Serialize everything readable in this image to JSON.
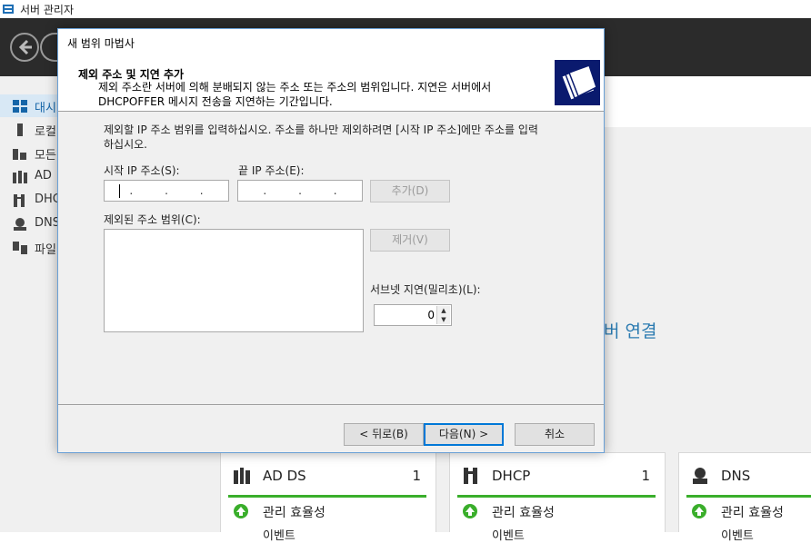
{
  "app": {
    "title": "서버 관리자"
  },
  "sidebar": {
    "items": [
      {
        "label": "대시",
        "icon": "dashboard-icon",
        "active": true
      },
      {
        "label": "로컬",
        "icon": "local-server-icon"
      },
      {
        "label": "모든",
        "icon": "all-servers-icon"
      },
      {
        "label": "AD",
        "icon": "ad-icon"
      },
      {
        "label": "DHC",
        "icon": "dhcp-icon"
      },
      {
        "label": "DNS",
        "icon": "dns-icon"
      },
      {
        "label": "파일",
        "icon": "file-services-icon"
      }
    ]
  },
  "main": {
    "connect_link": "버 연결",
    "tiles": [
      {
        "name": "AD DS",
        "count": "1",
        "status": "관리 효율성",
        "events": "이벤트"
      },
      {
        "name": "DHCP",
        "count": "1",
        "status": "관리 효율성",
        "events": "이벤트"
      },
      {
        "name": "DNS",
        "count": "",
        "status": "관리 효율성",
        "events": "이벤트"
      }
    ]
  },
  "dialog": {
    "title": "새 범위 마법사",
    "header_title": "제외 주소 및 지연 추가",
    "header_desc": "제외 주소란 서버에 의해 분배되지 않는 주소 또는 주소의 범위입니다. 지연은 서버에서 DHCPOFFER 메시지 전송을 지연하는 기간입니다.",
    "instructions": "제외할 IP 주소 범위를 입력하십시오. 주소를 하나만 제외하려면 [시작 IP 주소]에만 주소를 입력하십시오.",
    "start_ip_label": "시작 IP 주소(S):",
    "end_ip_label": "끝 IP 주소(E):",
    "add_button": "추가(D)",
    "excluded_label": "제외된 주소 범위(C):",
    "remove_button": "제거(V)",
    "delay_label": "서브넷 지연(밀리초)(L):",
    "delay_value": "0",
    "back_button": "< 뒤로(B)",
    "next_button": "다음(N) >",
    "cancel_button": "취소"
  }
}
